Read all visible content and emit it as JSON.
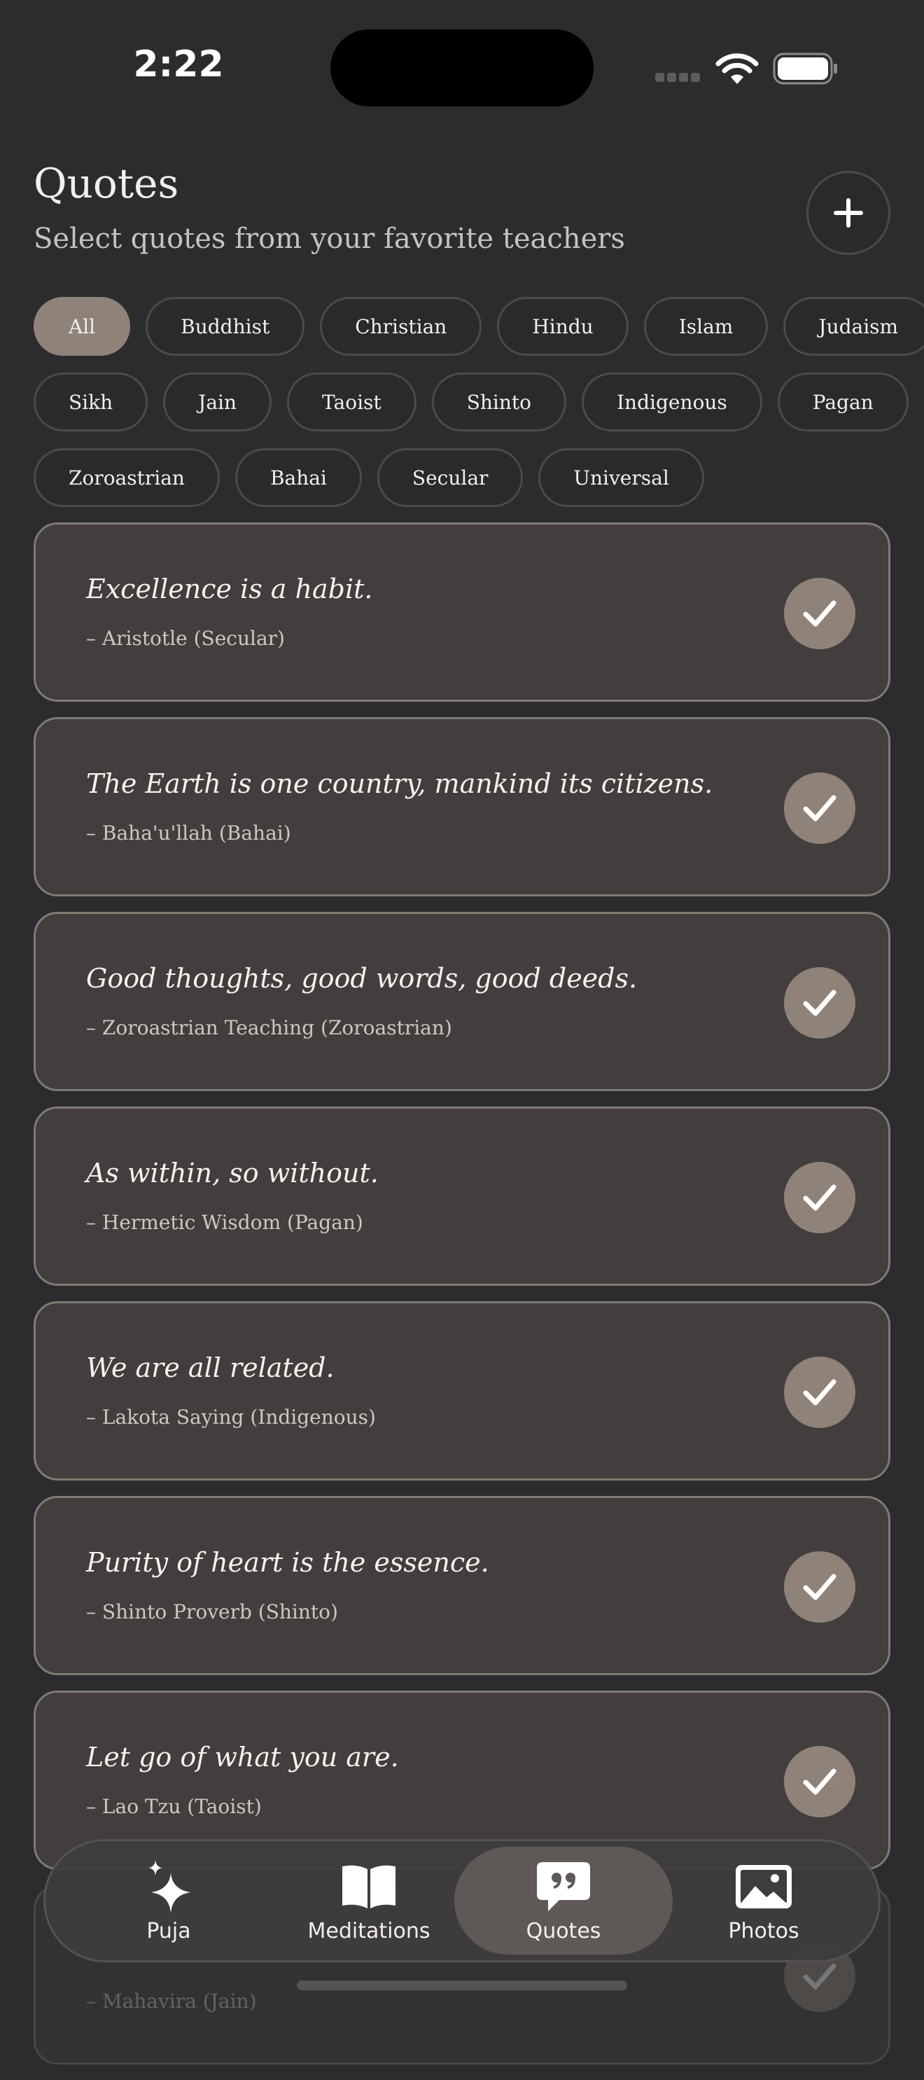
{
  "status_bar": {
    "time": "2:22"
  },
  "header": {
    "title": "Quotes",
    "subtitle": "Select quotes from your favorite teachers"
  },
  "filters": [
    [
      "All",
      "Buddhist",
      "Christian",
      "Hindu",
      "Islam",
      "Judaism"
    ],
    [
      "Sikh",
      "Jain",
      "Taoist",
      "Shinto",
      "Indigenous",
      "Pagan"
    ],
    [
      "Zoroastrian",
      "Bahai",
      "Secular",
      "Universal"
    ]
  ],
  "active_filter": "All",
  "quotes": [
    {
      "text": "Excellence is a habit.",
      "author": "– Aristotle (Secular)",
      "selected": true
    },
    {
      "text": "The Earth is one country, mankind its citizens.",
      "author": "– Baha'u'llah (Bahai)",
      "selected": true
    },
    {
      "text": "Good thoughts, good words, good deeds.",
      "author": "– Zoroastrian Teaching (Zoroastrian)",
      "selected": true
    },
    {
      "text": "As within, so without.",
      "author": "– Hermetic Wisdom (Pagan)",
      "selected": true
    },
    {
      "text": "We are all related.",
      "author": "– Lakota Saying (Indigenous)",
      "selected": true
    },
    {
      "text": "Purity of heart is the essence.",
      "author": "– Shinto Proverb (Shinto)",
      "selected": true
    },
    {
      "text": "Let go of what you are.",
      "author": "– Lao Tzu (Taoist)",
      "selected": true
    },
    {
      "text": "",
      "author": "– Mahavira (Jain)",
      "selected": true
    }
  ],
  "tabs": [
    {
      "label": "Puja",
      "icon": "sparkles-icon"
    },
    {
      "label": "Meditations",
      "icon": "book-icon"
    },
    {
      "label": "Quotes",
      "icon": "quote-bubble-icon",
      "active": true
    },
    {
      "label": "Photos",
      "icon": "photo-icon"
    }
  ],
  "colors": {
    "background": "#2c2c2e",
    "card": "#423e3d",
    "accent": "#8f8379"
  }
}
